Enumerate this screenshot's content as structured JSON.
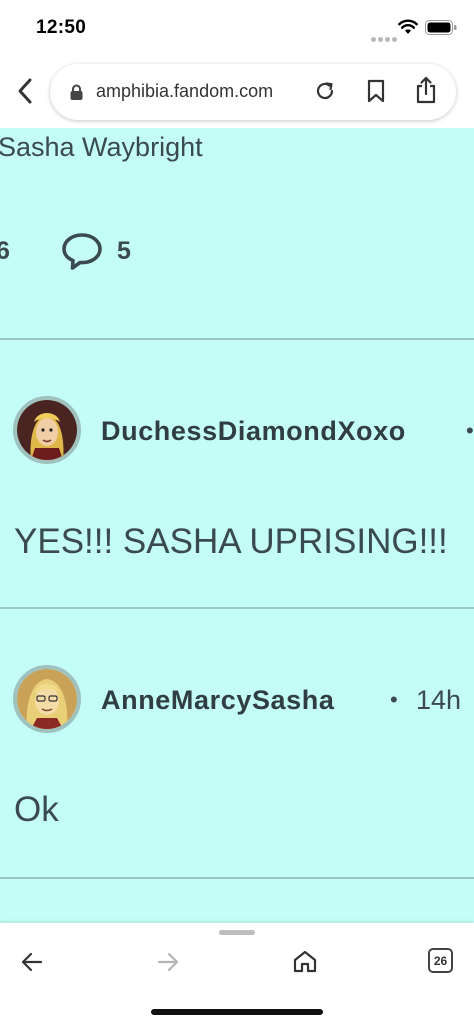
{
  "status_bar": {
    "time": "12:50",
    "icons": [
      "signal-dots-icon",
      "wifi-icon",
      "battery-icon"
    ]
  },
  "browser": {
    "url": "amphibia.fandom.com",
    "icons": [
      "back-chevron-icon",
      "lock-icon",
      "reload-icon",
      "bookmark-icon",
      "share-icon"
    ]
  },
  "post": {
    "title": "Sasha Waybright",
    "stat_left": "6",
    "comment_count": "5"
  },
  "replies": [
    {
      "username": "DuchessDiamondXoxo",
      "separator": "•",
      "body": "YES!!! SASHA UPRISING!!!"
    },
    {
      "username": "AnneMarcySasha",
      "separator": "•",
      "time": "14h",
      "body": "Ok"
    }
  ],
  "bottom_nav": {
    "tab_count": "26",
    "icons": [
      "arrow-left-icon",
      "arrow-right-icon",
      "home-icon",
      "tabs-icon"
    ]
  },
  "colors": {
    "content_bg": "#c4fcf7",
    "divider": "#9cc7c3",
    "text": "#3a4a4f",
    "avatar_ring": "#9fc2bf"
  }
}
